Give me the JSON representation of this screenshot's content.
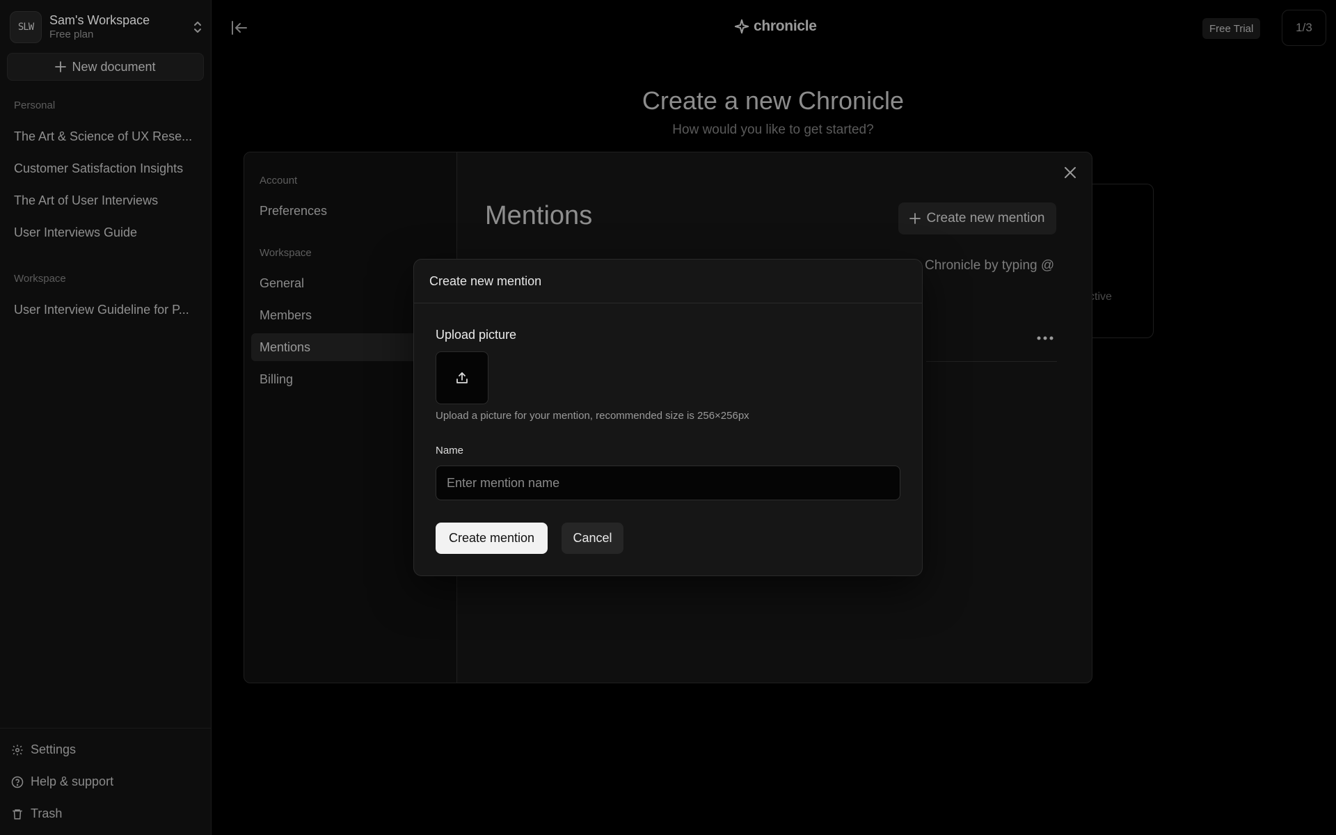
{
  "sidebar": {
    "workspace_avatar": "SLW",
    "workspace_name": "Sam's Workspace",
    "workspace_plan": "Free plan",
    "new_document_label": "New document",
    "personal_label": "Personal",
    "personal_items": [
      "The Art & Science of UX Rese...",
      "Customer Satisfaction Insights",
      "The Art of User Interviews",
      "User Interviews Guide"
    ],
    "workspace_label": "Workspace",
    "workspace_items": [
      "User Interview Guideline for P..."
    ],
    "settings_label": "Settings",
    "help_label": "Help & support",
    "trash_label": "Trash"
  },
  "topbar": {
    "brand": "chronicle",
    "trial_badge": "Free Trial",
    "page_counter": "1/3"
  },
  "page": {
    "title": "Create a new Chronicle",
    "subtitle": "How would you like to get started?",
    "card_fragment": "ctive"
  },
  "settings": {
    "nav_account_label": "Account",
    "nav_preferences": "Preferences",
    "nav_workspace_label": "Workspace",
    "nav_general": "General",
    "nav_members": "Members",
    "nav_mentions": "Mentions",
    "nav_billing": "Billing",
    "title": "Mentions",
    "create_button": "Create new mention",
    "description_fragment": "Chronicle by typing @"
  },
  "modal": {
    "title": "Create new mention",
    "upload_label": "Upload picture",
    "upload_help": "Upload a picture for your mention, recommended size is 256×256px",
    "name_label": "Name",
    "name_placeholder": "Enter mention name",
    "name_value": "",
    "submit_label": "Create mention",
    "cancel_label": "Cancel"
  }
}
